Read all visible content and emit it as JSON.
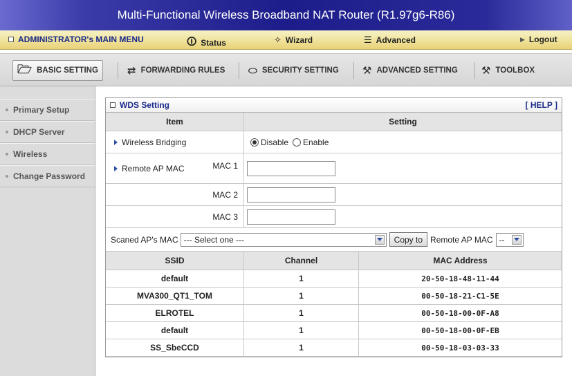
{
  "window": {
    "title": "Multi-Functional Wireless Broadband NAT Router (R1.97g6-R86)"
  },
  "menu": {
    "admin_label": "ADMINISTRATOR's MAIN MENU",
    "status_label": "Status",
    "wizard_label": "Wizard",
    "advanced_label": "Advanced",
    "logout_label": "Logout"
  },
  "tabs": [
    {
      "label": "BASIC SETTING",
      "icon": "folder-icon"
    },
    {
      "label": "FORWARDING RULES",
      "icon": "forward-arrows-icon"
    },
    {
      "label": "SECURITY SETTING",
      "icon": "lock-ring-icon"
    },
    {
      "label": "ADVANCED SETTING",
      "icon": "wrench-icon"
    },
    {
      "label": "TOOLBOX",
      "icon": "toolbox-icon"
    }
  ],
  "sidebar": {
    "items": [
      {
        "label": "Primary Setup"
      },
      {
        "label": "DHCP Server"
      },
      {
        "label": "Wireless"
      },
      {
        "label": "Change Password"
      }
    ]
  },
  "panel": {
    "title": "WDS Setting",
    "help": "[ HELP ]",
    "col_item": "Item",
    "col_setting": "Setting",
    "bridging_label": "Wireless Bridging",
    "disable_label": "Disable",
    "enable_label": "Enable",
    "remote_ap_label": "Remote AP MAC",
    "mac1_label": "MAC 1",
    "mac2_label": "MAC 2",
    "mac3_label": "MAC 3",
    "mac1_value": "",
    "mac2_value": "",
    "mac3_value": "",
    "scanned_label": "Scaned AP's MAC",
    "scanned_select": "--- Select one ---",
    "copy_button": "Copy to",
    "remote_ap_select_label": "Remote AP MAC",
    "remote_ap_select": "--"
  },
  "ap_table": {
    "headers": [
      "SSID",
      "Channel",
      "MAC Address"
    ],
    "rows": [
      [
        "default",
        "1",
        "20-50-18-48-11-44"
      ],
      [
        "MVA300_QT1_TOM",
        "1",
        "00-50-18-21-C1-5E"
      ],
      [
        "ELROTEL",
        "1",
        "00-50-18-00-0F-A8"
      ],
      [
        "default",
        "1",
        "00-50-18-00-0F-EB"
      ],
      [
        "SS_SbeCCD",
        "1",
        "00-50-18-03-03-33"
      ]
    ]
  },
  "colors": {
    "title_bar": "#1c1c8a",
    "menu_bar": "#efe29a",
    "link_blue": "#1a2a8a"
  }
}
